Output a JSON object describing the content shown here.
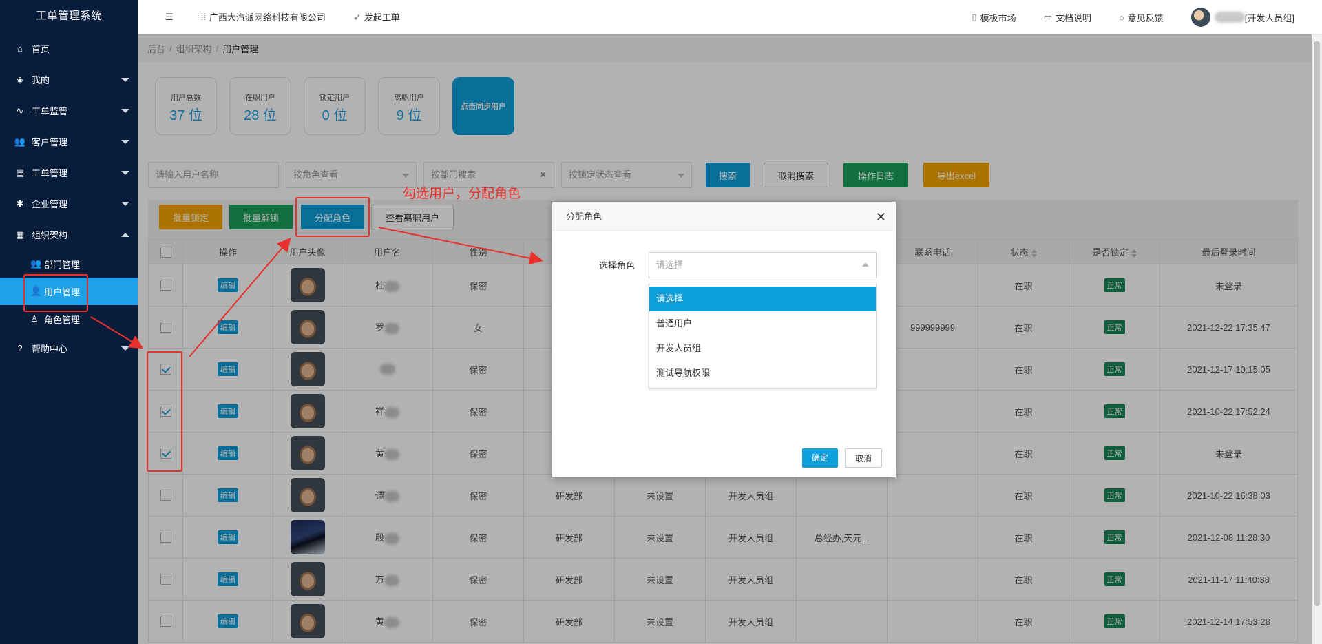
{
  "app": {
    "title": "工单管理系统"
  },
  "header": {
    "menu_toggle_icon": "hamburger",
    "company": "广西大汽派网络科技有限公司",
    "new_ticket": "发起工单",
    "template_market": "模板市场",
    "docs": "文档说明",
    "feedback": "意见反馈",
    "user_role": "[开发人员组]"
  },
  "sidebar": {
    "items": [
      {
        "label": "首页",
        "icon": "home-icon"
      },
      {
        "label": "我的",
        "icon": "layers-icon"
      },
      {
        "label": "工单监管",
        "icon": "pulse-icon"
      },
      {
        "label": "客户管理",
        "icon": "users-icon"
      },
      {
        "label": "工单管理",
        "icon": "clipboard-icon"
      },
      {
        "label": "企业管理",
        "icon": "gear-icon"
      },
      {
        "label": "组织架构",
        "icon": "calendar-icon"
      }
    ],
    "sub_items": [
      {
        "label": "部门管理"
      },
      {
        "label": "用户管理"
      },
      {
        "label": "角色管理"
      }
    ],
    "help": "帮助中心"
  },
  "breadcrumb": {
    "root": "后台",
    "mid": "组织架构",
    "current": "用户管理",
    "sep": "/"
  },
  "stats": [
    {
      "label": "用户总数",
      "value": "37 位"
    },
    {
      "label": "在职用户",
      "value": "28 位"
    },
    {
      "label": "锁定用户",
      "value": "0 位"
    },
    {
      "label": "离职用户",
      "value": "9 位"
    }
  ],
  "sync_button": "点击同步用户",
  "filters": {
    "username_placeholder": "请输入用户名称",
    "role_placeholder": "按角色查看",
    "dept_placeholder": "按部门搜索",
    "lock_placeholder": "按锁定状态查看",
    "search": "搜索",
    "cancel_search": "取消搜索",
    "log": "操作日志",
    "export": "导出excel"
  },
  "toolbar": {
    "batch_lock": "批量锁定",
    "batch_unlock": "批量解锁",
    "assign_role": "分配角色",
    "view_resigned": "查看离职用户"
  },
  "annotation": "勾选用户，分配角色",
  "table": {
    "headers": [
      "操作",
      "用户头像",
      "用户名",
      "性别",
      "",
      "",
      "",
      "",
      "联系电话",
      "状态",
      "是否锁定",
      "最后登录时间"
    ],
    "edit_label": "编辑",
    "rows": [
      {
        "checked": false,
        "name": "杜",
        "gender": "保密",
        "dept": "",
        "post": "",
        "role": "",
        "leader": "",
        "phone": "",
        "status": "在职",
        "lock": "正常",
        "last_login": "未登录"
      },
      {
        "checked": false,
        "name": "罗",
        "gender": "女",
        "dept": "",
        "post": "",
        "role": "",
        "leader": "",
        "phone": "999999999",
        "status": "在职",
        "lock": "正常",
        "last_login": "2021-12-22 17:35:47"
      },
      {
        "checked": true,
        "name": "",
        "gender": "保密",
        "dept": "",
        "post": "",
        "role": "",
        "leader": "",
        "phone": "",
        "status": "在职",
        "lock": "正常",
        "last_login": "2021-12-17 10:15:05"
      },
      {
        "checked": true,
        "name": "祥",
        "gender": "保密",
        "dept": "",
        "post": "",
        "role": "",
        "leader": "",
        "phone": "",
        "status": "在职",
        "lock": "正常",
        "last_login": "2021-10-22 17:52:24"
      },
      {
        "checked": true,
        "name": "黄",
        "gender": "保密",
        "dept": "",
        "post": "",
        "role": "",
        "leader": "",
        "phone": "",
        "status": "在职",
        "lock": "正常",
        "last_login": "未登录"
      },
      {
        "checked": false,
        "name": "谭",
        "gender": "保密",
        "dept": "研发部",
        "post": "未设置",
        "role": "开发人员组",
        "leader": "",
        "phone": "",
        "status": "在职",
        "lock": "正常",
        "last_login": "2021-10-22 16:38:03"
      },
      {
        "checked": false,
        "name": "殷",
        "gender": "保密",
        "dept": "研发部",
        "post": "未设置",
        "role": "开发人员组",
        "leader": "总经办,天元...",
        "phone": "",
        "status": "在职",
        "lock": "正常",
        "last_login": "2021-12-08 11:28:30"
      },
      {
        "checked": false,
        "name": "万",
        "gender": "保密",
        "dept": "研发部",
        "post": "未设置",
        "role": "开发人员组",
        "leader": "",
        "phone": "",
        "status": "在职",
        "lock": "正常",
        "last_login": "2021-11-17 11:40:38"
      },
      {
        "checked": false,
        "name": "黄",
        "gender": "保密",
        "dept": "研发部",
        "post": "未设置",
        "role": "开发人员组",
        "leader": "",
        "phone": "",
        "status": "在职",
        "lock": "正常",
        "last_login": "2021-12-14 17:53:28"
      }
    ]
  },
  "modal": {
    "title": "分配角色",
    "field_label": "选择角色",
    "placeholder": "请选择",
    "options": [
      "请选择",
      "普通用户",
      "开发人员组",
      "测试导航权限"
    ],
    "confirm": "确定",
    "cancel": "取消"
  }
}
